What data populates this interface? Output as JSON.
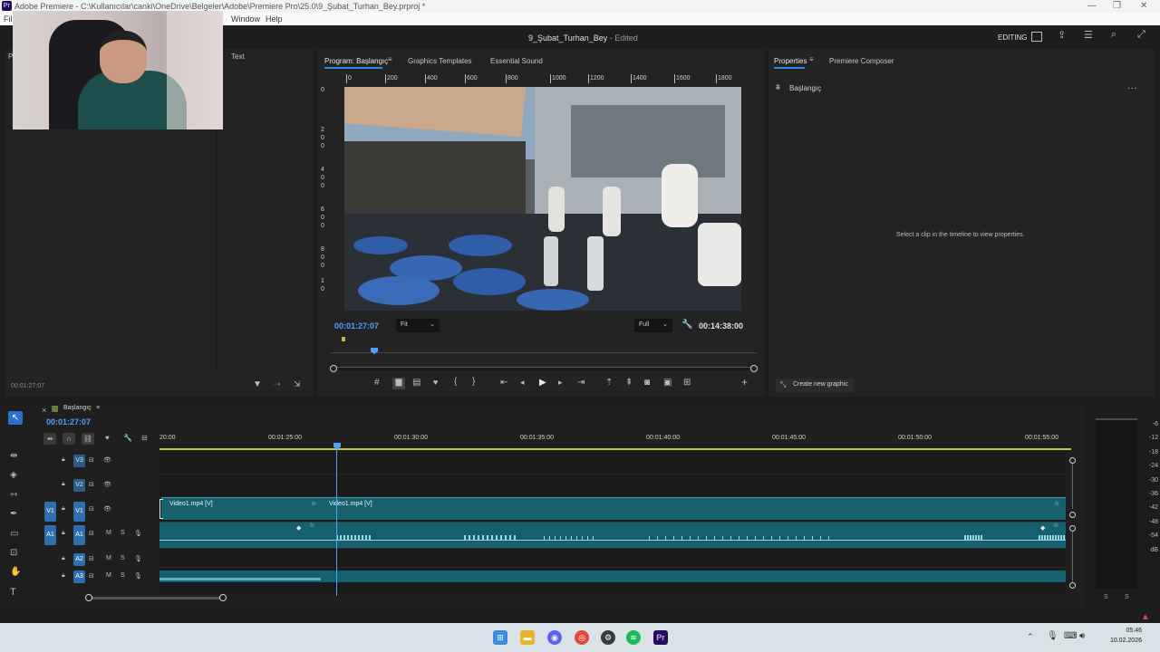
{
  "window": {
    "title": "Adobe Premiere - C:\\Kullanıcılar\\canki\\OneDrive\\Belgeler\\Adobe\\Premiere Pro\\25.0\\9_Şubat_Turhan_Bey.prproj *",
    "app_badge": "Pr"
  },
  "menu": {
    "file": "Fil",
    "window": "Window",
    "help": "Help"
  },
  "header": {
    "project_name": "9_Şubat_Turhan_Bey",
    "status": "- Edited",
    "workspace": "EDITING"
  },
  "left_panel": {
    "tab_partial": "P",
    "text_tab": "Text",
    "timecode": "00:01:27:07"
  },
  "program_monitor": {
    "tabs": [
      "Program: Başlangıç",
      "Graphics Templates",
      "Essential Sound"
    ],
    "ruler_labels": [
      "0",
      "200",
      "400",
      "600",
      "800",
      "1000",
      "1200",
      "1400",
      "1600",
      "1800"
    ],
    "vruler_labels": [
      "0",
      "2",
      "0",
      "0",
      "4",
      "0",
      "0",
      "6",
      "0",
      "0",
      "8",
      "0",
      "0",
      "1",
      "0"
    ],
    "current_timecode": "00:01:27:07",
    "fit": "Fit",
    "resolution": "Full",
    "duration": "00:14:38:00"
  },
  "properties": {
    "tabs": [
      "Properties",
      "Premiere Composer"
    ],
    "sequence_name": "Başlangıç",
    "empty_message": "Select a clip in the timeline to view properties.",
    "create_graphic": "Create new graphic",
    "more": "..."
  },
  "timeline": {
    "sequence_name": "Başlangıç",
    "timecode": "00:01:27:07",
    "ruler_labels": [
      "20:00",
      "00:01:25:00",
      "00:01:30:00",
      "00:01:35:00",
      "00:01:40:00",
      "00:01:45:00",
      "00:01:50:00",
      "00:01:55:00"
    ],
    "video_tracks": [
      {
        "name": "V3",
        "src": ""
      },
      {
        "name": "V2",
        "src": ""
      },
      {
        "name": "V1",
        "src": "V1"
      }
    ],
    "audio_tracks": [
      {
        "name": "A1",
        "src": "A1"
      },
      {
        "name": "A2",
        "src": ""
      },
      {
        "name": "A3",
        "src": ""
      }
    ],
    "m_label": "M",
    "s_label": "S",
    "clip1": "Video1.mp4 [V]",
    "clip2": "Video1.mp4 [V]",
    "fx": "fx"
  },
  "meter": {
    "labels": [
      "-6",
      "-12",
      "-18",
      "-24",
      "-30",
      "-36",
      "-42",
      "-48",
      "-54",
      "dB"
    ],
    "solo_l": "S",
    "solo_r": "S"
  },
  "taskbar": {
    "time": "05:46",
    "date": "10.02.2026"
  }
}
